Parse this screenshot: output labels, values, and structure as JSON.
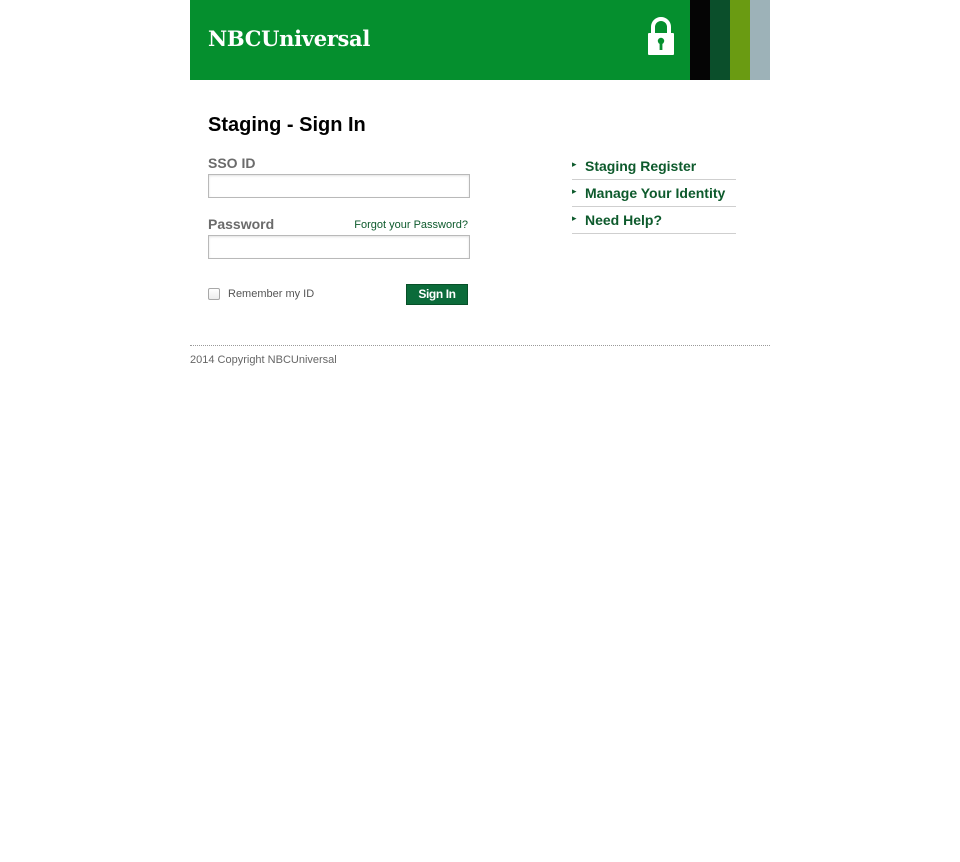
{
  "header": {
    "logo_text": "NBCUniversal",
    "background_color": "#058f2e",
    "stripe_colors": [
      "#050505",
      "#0b4f2b",
      "#6a9b12",
      "#9db2b8"
    ]
  },
  "form": {
    "title": "Staging - Sign In",
    "sso_label": "SSO ID",
    "sso_value": "",
    "password_label": "Password",
    "password_value": "",
    "forgot_link": "Forgot your Password?",
    "remember_label": "Remember my ID",
    "remember_checked": false,
    "signin_button": "Sign In",
    "button_color": "#0b6b3a"
  },
  "side_links": [
    {
      "label": "Staging Register",
      "icon": "chevron-right-icon"
    },
    {
      "label": "Manage Your Identity",
      "icon": "chevron-right-icon"
    },
    {
      "label": "Need Help?",
      "icon": "chevron-right-icon"
    }
  ],
  "footer": {
    "copyright": "2014 Copyright NBCUniversal"
  }
}
